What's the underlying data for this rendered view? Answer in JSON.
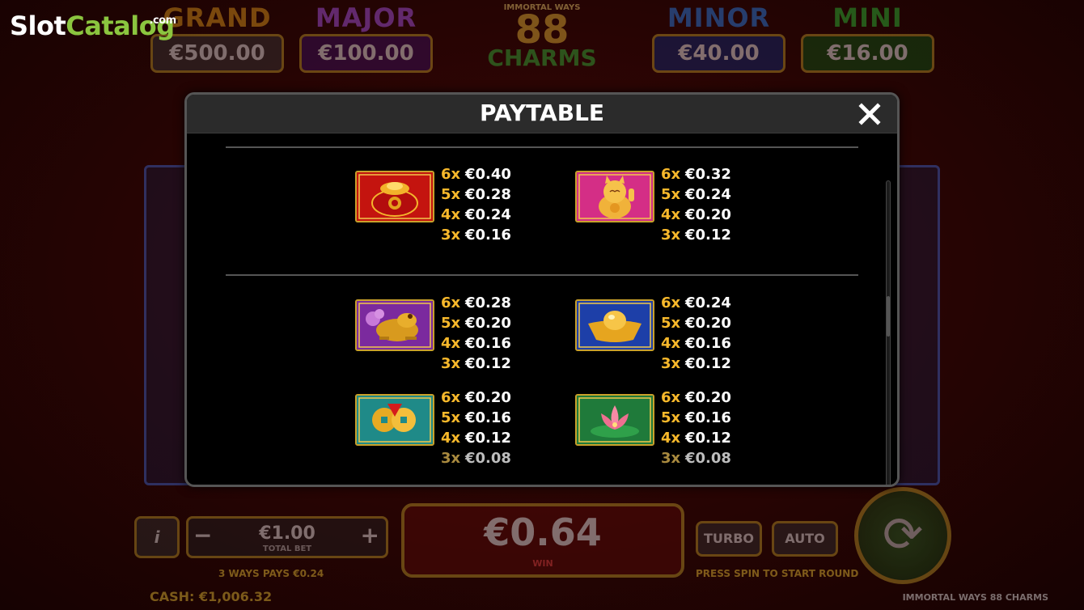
{
  "site_logo": {
    "part1": "Slot",
    "part2": "Catalog",
    "suffix": ".com"
  },
  "jackpots": [
    {
      "name": "GRAND",
      "value": "€500.00"
    },
    {
      "name": "MAJOR",
      "value": "€100.00"
    },
    {
      "name": "MINOR",
      "value": "€40.00"
    },
    {
      "name": "MINI",
      "value": "€16.00"
    }
  ],
  "game_logo": {
    "top": "IMMORTAL WAYS",
    "number": "88",
    "word": "CHARMS"
  },
  "bottom": {
    "info_label": "i",
    "bet_value": "€1.00",
    "bet_label": "TOTAL BET",
    "minus": "−",
    "plus": "+",
    "win_value": "€0.64",
    "win_label": "WIN",
    "turbo": "TURBO",
    "auto": "AUTO",
    "ways_text": "3 WAYS PAYS €0.24",
    "tip_text": "PRESS SPIN TO START ROUND",
    "cash_label": "CASH:",
    "cash_value": "€1,006.32",
    "game_name": "IMMORTAL WAYS 88 CHARMS"
  },
  "paytable": {
    "title": "PAYTABLE",
    "close_label": "close",
    "symbols": [
      {
        "icon": "gold-pot-symbol",
        "pays": [
          [
            "6x",
            "€0.40"
          ],
          [
            "5x",
            "€0.28"
          ],
          [
            "4x",
            "€0.24"
          ],
          [
            "3x",
            "€0.16"
          ]
        ]
      },
      {
        "icon": "lucky-cat-symbol",
        "pays": [
          [
            "6x",
            "€0.32"
          ],
          [
            "5x",
            "€0.24"
          ],
          [
            "4x",
            "€0.20"
          ],
          [
            "3x",
            "€0.12"
          ]
        ]
      },
      {
        "icon": "gold-frog-symbol",
        "pays": [
          [
            "6x",
            "€0.28"
          ],
          [
            "5x",
            "€0.20"
          ],
          [
            "4x",
            "€0.16"
          ],
          [
            "3x",
            "€0.12"
          ]
        ]
      },
      {
        "icon": "gold-ingot-symbol",
        "pays": [
          [
            "6x",
            "€0.24"
          ],
          [
            "5x",
            "€0.20"
          ],
          [
            "4x",
            "€0.16"
          ],
          [
            "3x",
            "€0.12"
          ]
        ]
      },
      {
        "icon": "gold-coins-symbol",
        "pays": [
          [
            "6x",
            "€0.20"
          ],
          [
            "5x",
            "€0.16"
          ],
          [
            "4x",
            "€0.12"
          ],
          [
            "3x",
            "€0.08"
          ]
        ]
      },
      {
        "icon": "lotus-symbol",
        "pays": [
          [
            "6x",
            "€0.20"
          ],
          [
            "5x",
            "€0.16"
          ],
          [
            "4x",
            "€0.12"
          ],
          [
            "3x",
            "€0.08"
          ]
        ]
      }
    ]
  },
  "colors": {
    "multiplier": "#f7b82b",
    "frame_gold": "#c9a12b",
    "logo_green": "#8bc53f"
  }
}
